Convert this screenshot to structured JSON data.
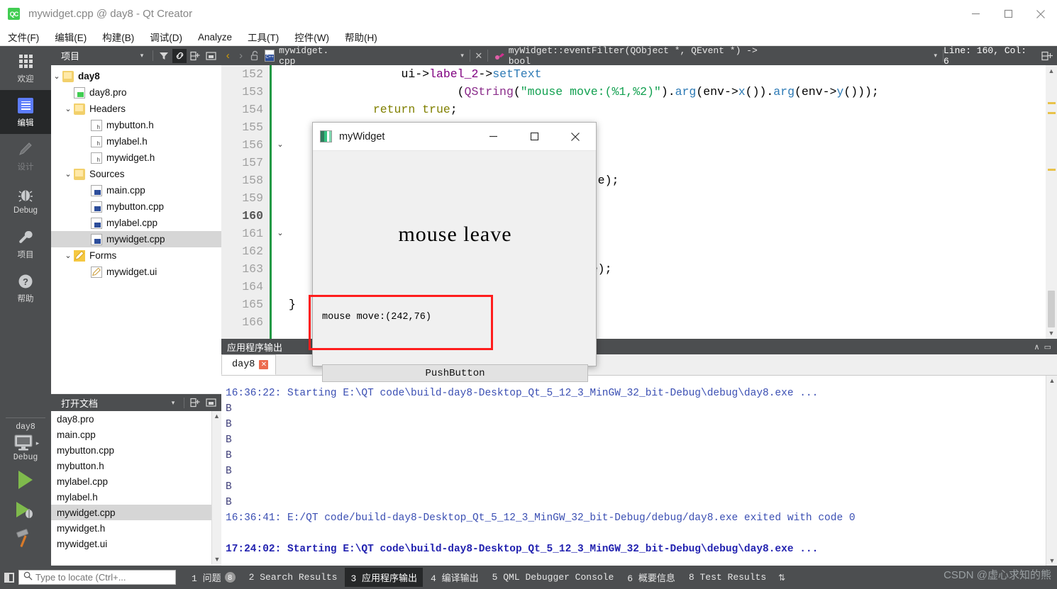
{
  "window": {
    "title": "mywidget.cpp @ day8 - Qt Creator",
    "logo_text": "QC",
    "minimize": "—",
    "maximize": "☐",
    "close": "✕"
  },
  "menubar": {
    "items": [
      {
        "label": "文件(F)"
      },
      {
        "label": "编辑(E)"
      },
      {
        "label": "构建(B)"
      },
      {
        "label": "调试(D)"
      },
      {
        "label": "Analyze"
      },
      {
        "label": "工具(T)"
      },
      {
        "label": "控件(W)"
      },
      {
        "label": "帮助(H)"
      }
    ]
  },
  "modebar": {
    "modes": [
      {
        "label": "欢迎",
        "icon": "grid-icon",
        "state": "normal"
      },
      {
        "label": "编辑",
        "icon": "document-icon",
        "state": "selected"
      },
      {
        "label": "设计",
        "icon": "pencil-icon",
        "state": "disabled"
      },
      {
        "label": "Debug",
        "icon": "bug-icon",
        "state": "normal"
      },
      {
        "label": "项目",
        "icon": "wrench-icon",
        "state": "normal"
      },
      {
        "label": "帮助",
        "icon": "question-icon",
        "state": "normal"
      }
    ],
    "kit": {
      "project": "day8",
      "config": "Debug"
    },
    "run_button": "run-icon",
    "debug_button": "run-debug-icon",
    "build_button": "hammer-icon"
  },
  "project_panel": {
    "title": "项目",
    "tools": [
      "filter-icon",
      "link-icon",
      "split-icon",
      "close-panel-icon"
    ],
    "tree": [
      {
        "label": "day8",
        "depth": 0,
        "chevron": "⌄",
        "icon": "qt-project-icon",
        "bold": true,
        "selected": false
      },
      {
        "label": "day8.pro",
        "depth": 1,
        "chevron": "",
        "icon": "pro-file-icon",
        "bold": false,
        "selected": false
      },
      {
        "label": "Headers",
        "depth": 1,
        "chevron": "⌄",
        "icon": "headers-folder-icon",
        "bold": false,
        "selected": false
      },
      {
        "label": "mybutton.h",
        "depth": 2,
        "chevron": "",
        "icon": "header-file-icon",
        "bold": false,
        "selected": false
      },
      {
        "label": "mylabel.h",
        "depth": 2,
        "chevron": "",
        "icon": "header-file-icon",
        "bold": false,
        "selected": false
      },
      {
        "label": "mywidget.h",
        "depth": 2,
        "chevron": "",
        "icon": "header-file-icon",
        "bold": false,
        "selected": false
      },
      {
        "label": "Sources",
        "depth": 1,
        "chevron": "⌄",
        "icon": "sources-folder-icon",
        "bold": false,
        "selected": false
      },
      {
        "label": "main.cpp",
        "depth": 2,
        "chevron": "",
        "icon": "cpp-file-icon",
        "bold": false,
        "selected": false
      },
      {
        "label": "mybutton.cpp",
        "depth": 2,
        "chevron": "",
        "icon": "cpp-file-icon",
        "bold": false,
        "selected": false
      },
      {
        "label": "mylabel.cpp",
        "depth": 2,
        "chevron": "",
        "icon": "cpp-file-icon",
        "bold": false,
        "selected": false
      },
      {
        "label": "mywidget.cpp",
        "depth": 2,
        "chevron": "",
        "icon": "cpp-file-icon",
        "bold": false,
        "selected": true
      },
      {
        "label": "Forms",
        "depth": 1,
        "chevron": "⌄",
        "icon": "forms-folder-icon",
        "bold": false,
        "selected": false
      },
      {
        "label": "mywidget.ui",
        "depth": 2,
        "chevron": "",
        "icon": "ui-file-icon",
        "bold": false,
        "selected": false
      }
    ]
  },
  "open_documents": {
    "title": "打开文档",
    "files": [
      {
        "label": "day8.pro",
        "selected": false
      },
      {
        "label": "main.cpp",
        "selected": false
      },
      {
        "label": "mybutton.cpp",
        "selected": false
      },
      {
        "label": "mybutton.h",
        "selected": false
      },
      {
        "label": "mylabel.cpp",
        "selected": false
      },
      {
        "label": "mylabel.h",
        "selected": false
      },
      {
        "label": "mywidget.cpp",
        "selected": true
      },
      {
        "label": "mywidget.h",
        "selected": false
      },
      {
        "label": "mywidget.ui",
        "selected": false
      }
    ]
  },
  "editor_toolbar": {
    "back": "‹",
    "forward": "›",
    "lock_icon": "unlocked-icon",
    "filename": "mywidget. cpp",
    "close_label": "✕",
    "symbol": "myWidget::eventFilter(QObject *, QEvent *) -> bool",
    "position": "Line: 160, Col: 6",
    "split_icon": "split-editor-icon"
  },
  "code": {
    "lines": [
      {
        "num": "152",
        "fold": "",
        "current": false,
        "tokens": [
          {
            "t": "                ",
            "c": "k-op"
          },
          {
            "t": "ui",
            "c": "k-op"
          },
          {
            "t": "->",
            "c": "k-op"
          },
          {
            "t": "label_2",
            "c": "k-var"
          },
          {
            "t": "->",
            "c": "k-op"
          },
          {
            "t": "setText",
            "c": "k-fn"
          }
        ]
      },
      {
        "num": "153",
        "fold": "",
        "current": false,
        "tokens": [
          {
            "t": "                        (",
            "c": "k-op"
          },
          {
            "t": "QString",
            "c": "k-type"
          },
          {
            "t": "(",
            "c": "k-op"
          },
          {
            "t": "\"mouse move:(%1,%2)\"",
            "c": "k-str"
          },
          {
            "t": ").",
            "c": "k-op"
          },
          {
            "t": "arg",
            "c": "k-fn"
          },
          {
            "t": "(env->",
            "c": "k-op"
          },
          {
            "t": "x",
            "c": "k-fn"
          },
          {
            "t": "()).",
            "c": "k-op"
          },
          {
            "t": "arg",
            "c": "k-fn"
          },
          {
            "t": "(env->",
            "c": "k-op"
          },
          {
            "t": "y",
            "c": "k-fn"
          },
          {
            "t": "()));",
            "c": "k-op"
          }
        ]
      },
      {
        "num": "154",
        "fold": "",
        "current": false,
        "tokens": [
          {
            "t": "            ",
            "c": "k-op"
          },
          {
            "t": "return",
            "c": "k-kw"
          },
          {
            "t": " ",
            "c": "k-op"
          },
          {
            "t": "true",
            "c": "k-kw"
          },
          {
            "t": ";",
            "c": "k-op"
          }
        ]
      },
      {
        "num": "155",
        "fold": "",
        "current": false,
        "tokens": [
          {
            "t": "        }",
            "c": "k-op"
          }
        ]
      },
      {
        "num": "156",
        "fold": "⌄",
        "current": false,
        "tokens": []
      },
      {
        "num": "157",
        "fold": "",
        "current": false,
        "tokens": []
      },
      {
        "num": "158",
        "fold": "",
        "current": false,
        "tokens": [
          {
            "t": "                                    ter(obj,e);",
            "c": "k-fn-mixed"
          }
        ]
      },
      {
        "num": "159",
        "fold": "",
        "current": false,
        "tokens": []
      },
      {
        "num": "160",
        "fold": "",
        "current": true,
        "tokens": []
      },
      {
        "num": "161",
        "fold": "⌄",
        "current": false,
        "tokens": []
      },
      {
        "num": "162",
        "fold": "",
        "current": false,
        "tokens": []
      },
      {
        "num": "163",
        "fold": "",
        "current": false,
        "tokens": [
          {
            "t": "                                       obj,e);",
            "c": "k-op"
          }
        ]
      },
      {
        "num": "164",
        "fold": "",
        "current": false,
        "tokens": []
      },
      {
        "num": "165",
        "fold": "",
        "current": false,
        "tokens": [
          {
            "t": "}",
            "c": "k-op"
          }
        ]
      },
      {
        "num": "166",
        "fold": "",
        "current": false,
        "tokens": []
      }
    ]
  },
  "output_pane": {
    "title": "应用程序输出",
    "maximize_icon": "∧",
    "close_icon": "▭",
    "tab": {
      "label": "day8",
      "close": "✕"
    },
    "lines": [
      {
        "text": "16:36:22: Starting E:\\QT code\\build-day8-Desktop_Qt_5_12_3_MinGW_32_bit-Debug\\debug\\day8.exe ...",
        "style": "normal"
      },
      {
        "text": "B",
        "style": "normal"
      },
      {
        "text": "B",
        "style": "normal"
      },
      {
        "text": "B",
        "style": "normal"
      },
      {
        "text": "B",
        "style": "normal"
      },
      {
        "text": "B",
        "style": "normal"
      },
      {
        "text": "B",
        "style": "normal"
      },
      {
        "text": "B",
        "style": "normal"
      },
      {
        "text": "16:36:41: E:/QT code/build-day8-Desktop_Qt_5_12_3_MinGW_32_bit-Debug/debug/day8.exe exited with code 0",
        "style": "normal"
      },
      {
        "text": "",
        "style": "gap"
      },
      {
        "text": "17:24:02: Starting E:\\QT code\\build-day8-Desktop_Qt_5_12_3_MinGW_32_bit-Debug\\debug\\day8.exe ...",
        "style": "bold"
      }
    ]
  },
  "statusbar": {
    "sidebar_toggle": "sidebar-toggle-icon",
    "search_placeholder": "Type to locate (Ctrl+...",
    "search_value": "",
    "items": [
      {
        "label": "1 问题",
        "badge": "8",
        "active": false
      },
      {
        "label": "2 Search Results",
        "badge": "",
        "active": false
      },
      {
        "label": "3 应用程序输出",
        "badge": "",
        "active": true
      },
      {
        "label": "4 编译输出",
        "badge": "",
        "active": false
      },
      {
        "label": "5 QML Debugger Console",
        "badge": "",
        "active": false
      },
      {
        "label": "6 概要信息",
        "badge": "",
        "active": false
      },
      {
        "label": "8 Test Results",
        "badge": "",
        "active": false
      }
    ],
    "updown": "⇅",
    "watermark": "CSDN @虚心求知的熊"
  },
  "dialog": {
    "title": "myWidget",
    "minimize": "—",
    "maximize": "☐",
    "close": "✕",
    "big_label": "mouse leave",
    "move_label": "mouse move:(242,76)",
    "push_button": "PushButton",
    "highlight_color": "#ff1d1d"
  }
}
